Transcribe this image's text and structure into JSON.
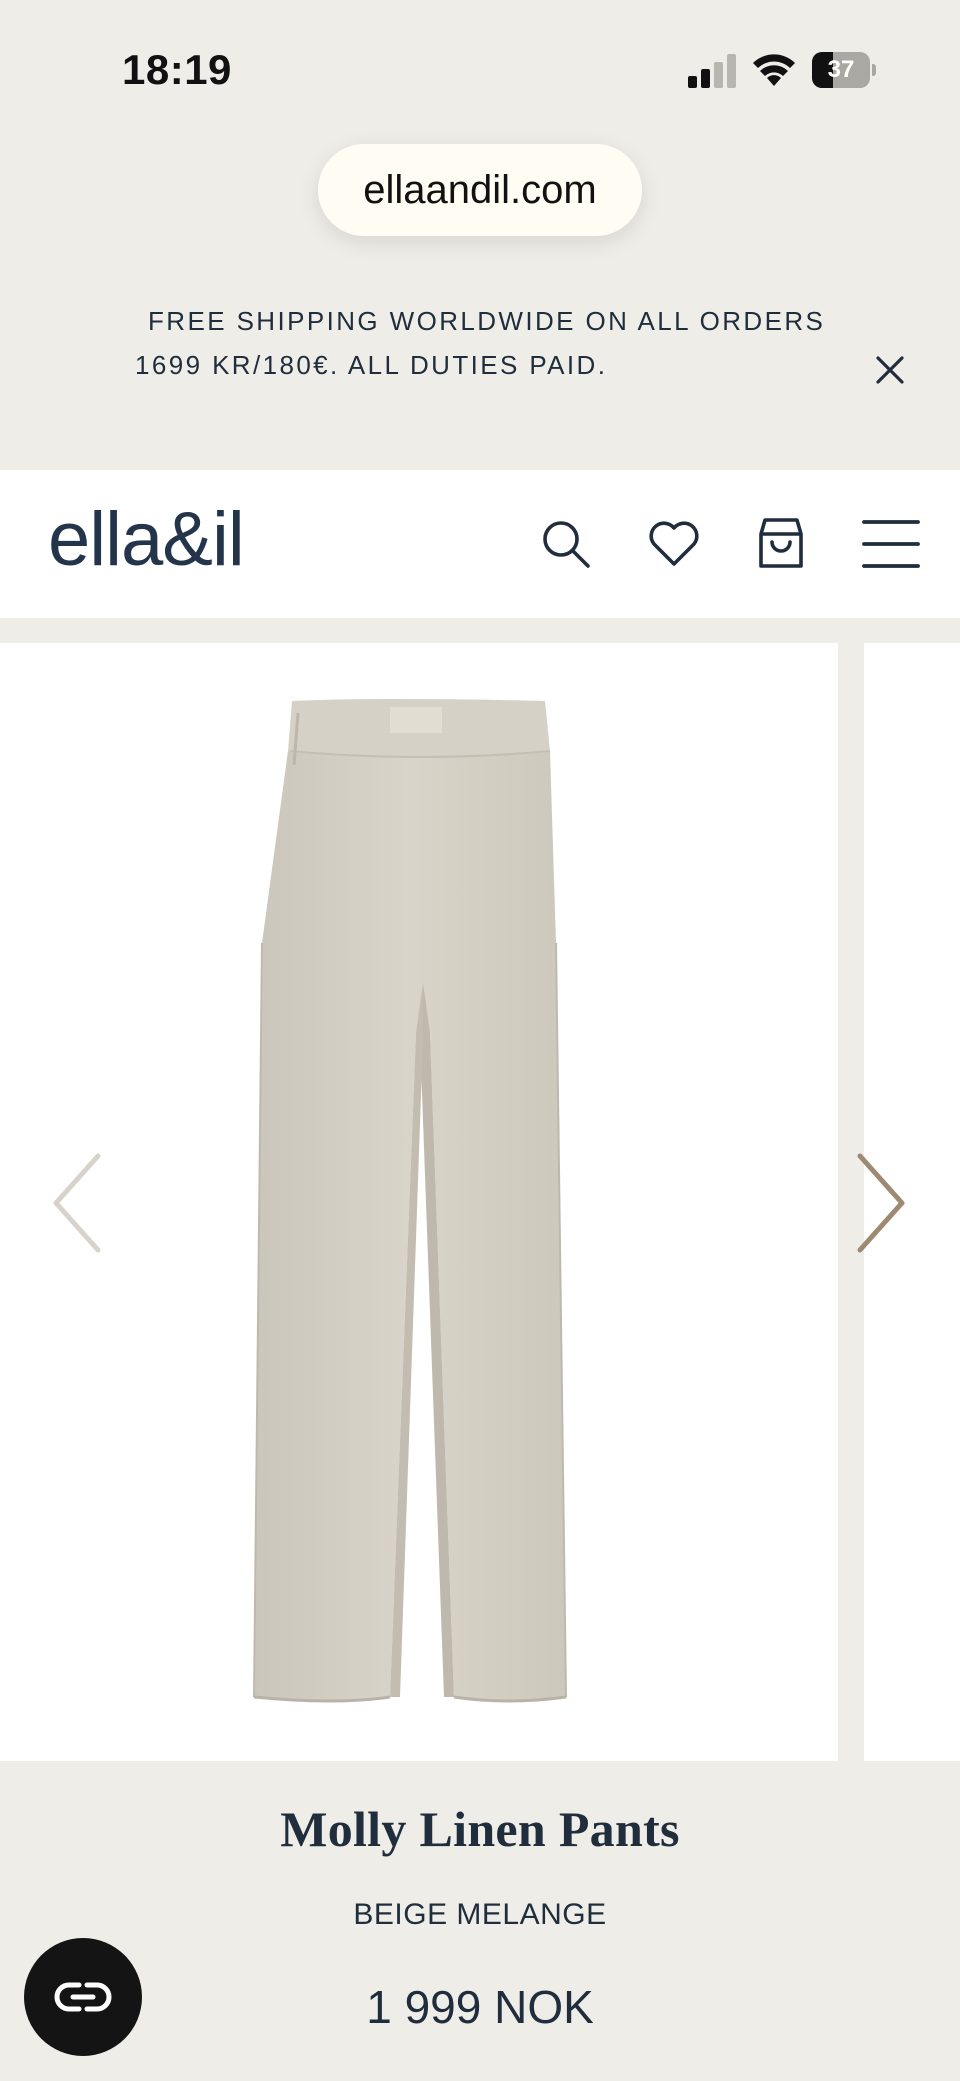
{
  "status_bar": {
    "time": "18:19",
    "battery": "37",
    "battery_level": 0.37
  },
  "browser": {
    "url": "ellaandil.com"
  },
  "announcement": {
    "line1": "FREE SHIPPING WORLDWIDE ON ALL ORDERS",
    "line2": "1699 KR/180€.  ALL DUTIES PAID."
  },
  "header": {
    "logo": "ella&il",
    "icons": [
      "search-icon",
      "heart-icon",
      "shopping-bag-icon",
      "menu-icon"
    ]
  },
  "gallery": {
    "icons": [
      "chevron-left-icon",
      "chevron-right-icon"
    ]
  },
  "product": {
    "title": "Molly Linen Pants",
    "color": "BEIGE MELANGE",
    "price": "1 999 NOK"
  },
  "chat": {
    "icon": "chat-icon"
  },
  "colors": {
    "background": "#efede8",
    "header_bg": "#ffffff",
    "text": "#1f2d3d",
    "pill_bg": "#fffcf4",
    "arrow": "#9c8a72",
    "chat_bg": "#141414"
  }
}
